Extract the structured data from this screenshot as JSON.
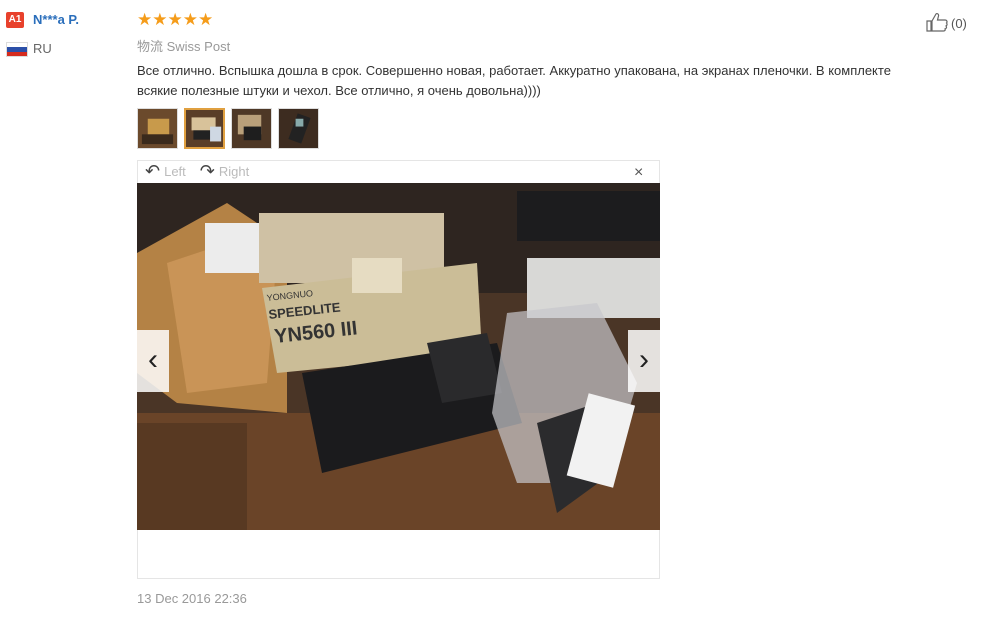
{
  "reviewer": {
    "badge": "A1",
    "name": "N***a P.",
    "country": "RU",
    "flag_colors": [
      "#ffffff",
      "#2b4fa8",
      "#d52b1e"
    ]
  },
  "review": {
    "rating_stars": "★★★★★",
    "rating": 5,
    "shipping": "物流 Swiss Post",
    "text": "Все отлично. Вспышка дошла в срок. Совершенно новая, работает. Аккуратно упакована, на экранах пленочки. В комплекте всякие полезные штуки и чехол. Все отлично, я очень довольна))))",
    "date": "13 Dec 2016 22:36",
    "likes": "(0)"
  },
  "viewer": {
    "rotate_left": "Left",
    "rotate_right": "Right",
    "close": "×",
    "prev": "‹",
    "next": "›",
    "thumbnail_count": 4,
    "active_thumbnail": 2
  },
  "photo": {
    "box_text_1": "YONGNUO",
    "box_text_2": "SPEEDLITE",
    "box_text_3": "YN560 III"
  },
  "colors": {
    "link": "#2a6ebb",
    "star": "#f59c1a",
    "muted": "#999999"
  }
}
